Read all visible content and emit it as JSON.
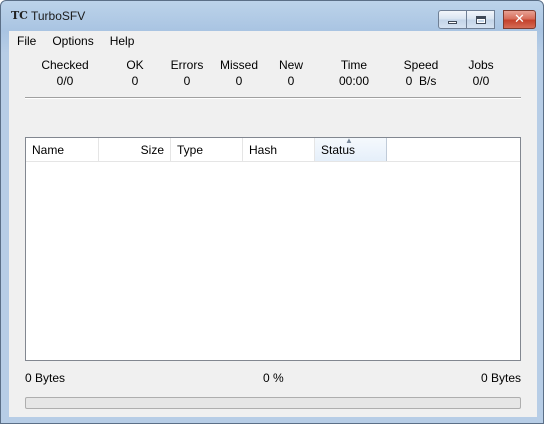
{
  "window": {
    "title": "TurboSFV",
    "app_icon_text": "TC"
  },
  "menu": [
    "File",
    "Options",
    "Help"
  ],
  "stats": [
    {
      "label": "Checked",
      "value": "0/0"
    },
    {
      "label": "OK",
      "value": "0"
    },
    {
      "label": "Errors",
      "value": "0"
    },
    {
      "label": "Missed",
      "value": "0"
    },
    {
      "label": "New",
      "value": "0"
    },
    {
      "label": "Time",
      "value": "00:00"
    },
    {
      "label": "Speed",
      "value": "0  B/s"
    },
    {
      "label": "Jobs",
      "value": "0/0"
    }
  ],
  "list": {
    "columns": [
      "Name",
      "Size",
      "Type",
      "Hash",
      "Status"
    ],
    "sorted_column": "Status",
    "rows": []
  },
  "footer": {
    "left": "0 Bytes",
    "center": "0 %",
    "right": "0 Bytes"
  },
  "progress": {
    "value": 0
  }
}
